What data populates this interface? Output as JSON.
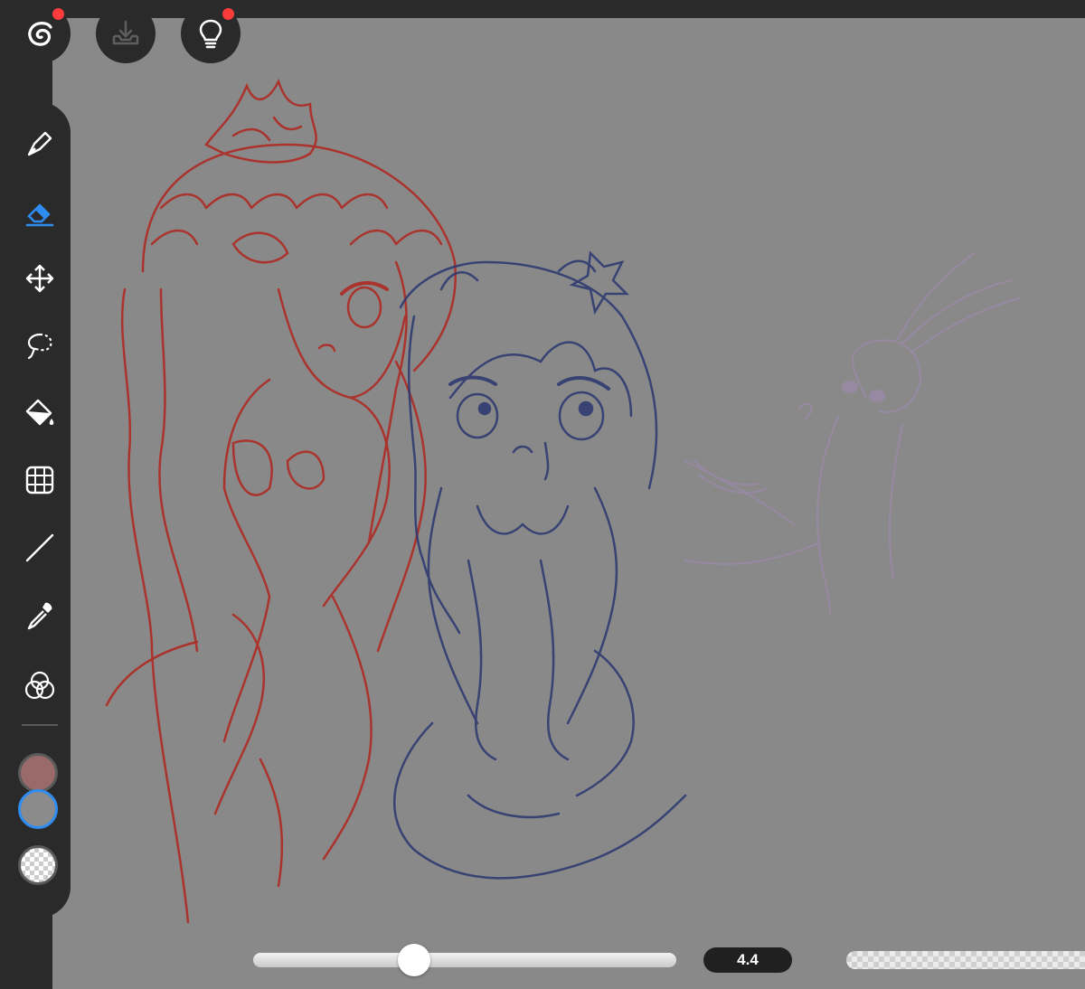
{
  "app": {
    "top_buttons": [
      {
        "icon": "app-logo-icon",
        "notification": true
      },
      {
        "icon": "import-tray-icon",
        "notification": false
      },
      {
        "icon": "lightbulb-icon",
        "notification": true
      }
    ]
  },
  "toolbar": {
    "tools": [
      {
        "name": "pen",
        "icon": "pen-icon",
        "active": false
      },
      {
        "name": "eraser",
        "icon": "eraser-icon",
        "active": true
      },
      {
        "name": "move",
        "icon": "move-icon",
        "active": false
      },
      {
        "name": "lasso",
        "icon": "lasso-icon",
        "active": false
      },
      {
        "name": "fill",
        "icon": "bucket-icon",
        "active": false
      },
      {
        "name": "transform",
        "icon": "grid-icon",
        "active": false
      },
      {
        "name": "line",
        "icon": "line-icon",
        "active": false
      },
      {
        "name": "eyedropper",
        "icon": "eyedropper-icon",
        "active": false
      },
      {
        "name": "color-mix",
        "icon": "color-mix-icon",
        "active": false
      }
    ],
    "colors": {
      "primary": "#9a6a6a",
      "secondary": "#8b8b8b",
      "accent": "#2f8cf0"
    }
  },
  "brush": {
    "size_value": "4.4",
    "size_fraction": 0.38
  },
  "theme": {
    "canvas_bg": "#898989",
    "chrome_bg": "#2b2b2b",
    "sketch_red": "#b0261e",
    "sketch_blue": "#2a3670",
    "sketch_purple": "#9b8aa8"
  }
}
